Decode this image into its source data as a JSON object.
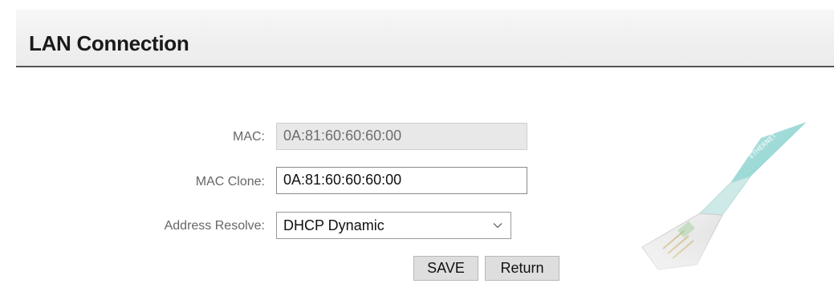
{
  "header": {
    "title": "LAN Connection"
  },
  "form": {
    "mac": {
      "label": "MAC:",
      "value": "0A:81:60:60:60:00"
    },
    "mac_clone": {
      "label": "MAC Clone:",
      "value": "0A:81:60:60:60:00"
    },
    "address_resolve": {
      "label": "Address Resolve:",
      "selected": "DHCP Dynamic"
    }
  },
  "buttons": {
    "save_label": "SAVE",
    "return_label": "Return"
  },
  "illustration": {
    "icon": "ethernet-cable-icon",
    "cable_label": "ETHERNET"
  },
  "colors": {
    "header_border": "#555555",
    "cable_teal": "#8fd3d0"
  }
}
